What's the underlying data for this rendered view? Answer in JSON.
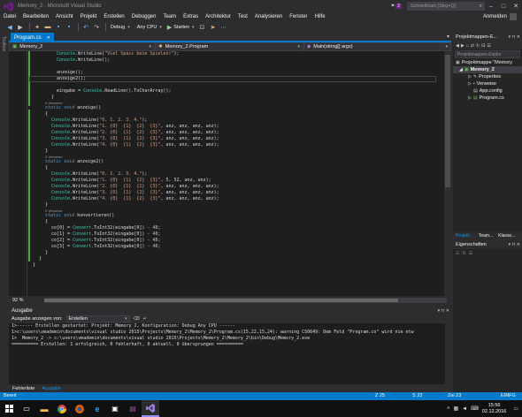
{
  "window": {
    "title": "Memory_2 - Microsoft Visual Studio",
    "notification_count": "2",
    "quick_launch_placeholder": "Schnellstart (Strg+Q)",
    "login_label": "Anmelden"
  },
  "menu": [
    "Datei",
    "Bearbeiten",
    "Ansicht",
    "Projekt",
    "Erstellen",
    "Debuggen",
    "Team",
    "Extras",
    "Architektur",
    "Test",
    "Analysieren",
    "Fenster",
    "Hilfe"
  ],
  "toolbar": {
    "config": "Debug",
    "platform": "Any CPU",
    "start_label": "Starten"
  },
  "left_strip_label": "Toolbox",
  "editor": {
    "tab_label": "Program.cs",
    "nav_project": "Memory_2",
    "nav_class": "Memory_2.Program",
    "nav_member": "Main(string[] args)",
    "zoom": "92 %"
  },
  "code": [
    {
      "kind": "code",
      "text": "Console.WriteLine(\"Viel Spass beim Spielen!\");"
    },
    {
      "kind": "code",
      "text": "Console.WriteLine();"
    },
    {
      "kind": "code",
      "text": ""
    },
    {
      "kind": "code",
      "text": "anzeige();"
    },
    {
      "kind": "code",
      "text": "anzeige2();"
    },
    {
      "kind": "code",
      "text": ""
    },
    {
      "kind": "code",
      "text": "eingabe = Console.ReadLine().ToCharArray();"
    },
    {
      "kind": "code",
      "text": "}"
    },
    {
      "kind": "ref",
      "text": "0 Verweise"
    },
    {
      "kind": "code",
      "text": "static void anzeige()"
    },
    {
      "kind": "code",
      "text": "{"
    },
    {
      "kind": "code",
      "text": "Console.WriteLine(\"0. 1. 2. 3. 4.\");"
    },
    {
      "kind": "code",
      "text": "Console.WriteLine(\"1. {0}  {1}  {2}  {3}\", anz, anz, anz, anz);"
    },
    {
      "kind": "code",
      "text": "Console.WriteLine(\"2. {0}  {1}  {2}  {3}\", anz, anz, anz, anz);"
    },
    {
      "kind": "code",
      "text": "Console.WriteLine(\"3. {0}  {1}  {2}  {3}\", anz, anz, anz, anz);"
    },
    {
      "kind": "code",
      "text": "Console.WriteLine(\"4. {0}  {1}  {2}  {3}\", anz, anz, anz, anz);"
    },
    {
      "kind": "code",
      "text": "}"
    },
    {
      "kind": "ref",
      "text": "0 Verweise"
    },
    {
      "kind": "code",
      "text": "static void anzeige2()"
    },
    {
      "kind": "code",
      "text": "{"
    },
    {
      "kind": "code",
      "text": "Console.WriteLine(\"0. 1. 2. 3. 4.\");"
    },
    {
      "kind": "code",
      "text": "Console.WriteLine(\"1. {0}  {1}  {2}  {3}\", 5, 52, anz, anz);"
    },
    {
      "kind": "code",
      "text": "Console.WriteLine(\"2. {0}  {1}  {2}  {3}\", anz, anz, anz, anz);"
    },
    {
      "kind": "code",
      "text": "Console.WriteLine(\"3. {0}  {1}  {2}  {3}\", anz, anz, anz, anz);"
    },
    {
      "kind": "code",
      "text": "Console.WriteLine(\"4. {0}  {1}  {2}  {3}\", anz, anz, anz, anz);"
    },
    {
      "kind": "code",
      "text": "}"
    },
    {
      "kind": "ref",
      "text": "0 Verweise"
    },
    {
      "kind": "code",
      "text": "static void konvertieren()"
    },
    {
      "kind": "code",
      "text": "{"
    },
    {
      "kind": "code",
      "text": "co[0] = Convert.ToInt32(eingabe[0]) - 48;"
    },
    {
      "kind": "code",
      "text": "co[1] = Convert.ToInt32(eingabe[0]) - 48;"
    },
    {
      "kind": "code",
      "text": "co[2] = Convert.ToInt32(eingabe[0]) - 48;"
    },
    {
      "kind": "code",
      "text": "co[3] = Convert.ToInt32(eingabe[0]) - 48;"
    },
    {
      "kind": "code",
      "text": "}"
    },
    {
      "kind": "code",
      "text": "}"
    },
    {
      "kind": "code",
      "text": "}"
    }
  ],
  "solution_explorer": {
    "title": "Projektmappen-E...",
    "search_placeholder": "Projektmappen-Explor",
    "items": [
      {
        "label": "Projektmappe \"Memory",
        "icon": "solution-icon"
      },
      {
        "label": "Memory_2",
        "icon": "csharp-project-icon"
      },
      {
        "label": "Properties",
        "icon": "wrench-icon"
      },
      {
        "label": "Verweise",
        "icon": "references-icon"
      },
      {
        "label": "App.config",
        "icon": "config-file-icon"
      },
      {
        "label": "Program.cs",
        "icon": "csharp-file-icon"
      }
    ],
    "tabs": [
      "Projekt...",
      "Team...",
      "Klasse..."
    ]
  },
  "properties": {
    "title": "Eigenschaften"
  },
  "output": {
    "title": "Ausgabe",
    "show_from_label": "Ausgabe anzeigen von:",
    "source": "Erstellen",
    "lines": [
      "1>------ Erstellen gestartet: Projekt: Memory_2, Konfiguration: Debug Any CPU ------",
      "1>c:\\users\\vmademin\\documents\\visual studio 2015\\Projects\\Memory_2\\Memory_2\\Program.cs(15,22,15,24): warning CS0649: Dem Feld \"Program.co\" wird nie etw",
      "1>  Memory_2 -> c:\\users\\vmademin\\documents\\visual studio 2015\\Projects\\Memory_2\\Memory_2\\bin\\Debug\\Memory_2.exe",
      "========== Erstellen: 1 erfolgreich, 0 fehlerhaft, 0 aktuell, 0 übersprungen =========="
    ]
  },
  "bottom_tabs": [
    "Fehlerliste",
    "Ausgabe"
  ],
  "status": {
    "state": "Bereit",
    "line": "Z 25",
    "col": "S 23",
    "char": "Zei 23",
    "mode": "EINFG"
  },
  "taskbar": {
    "time": "15:56",
    "date": "02.12.2016"
  }
}
